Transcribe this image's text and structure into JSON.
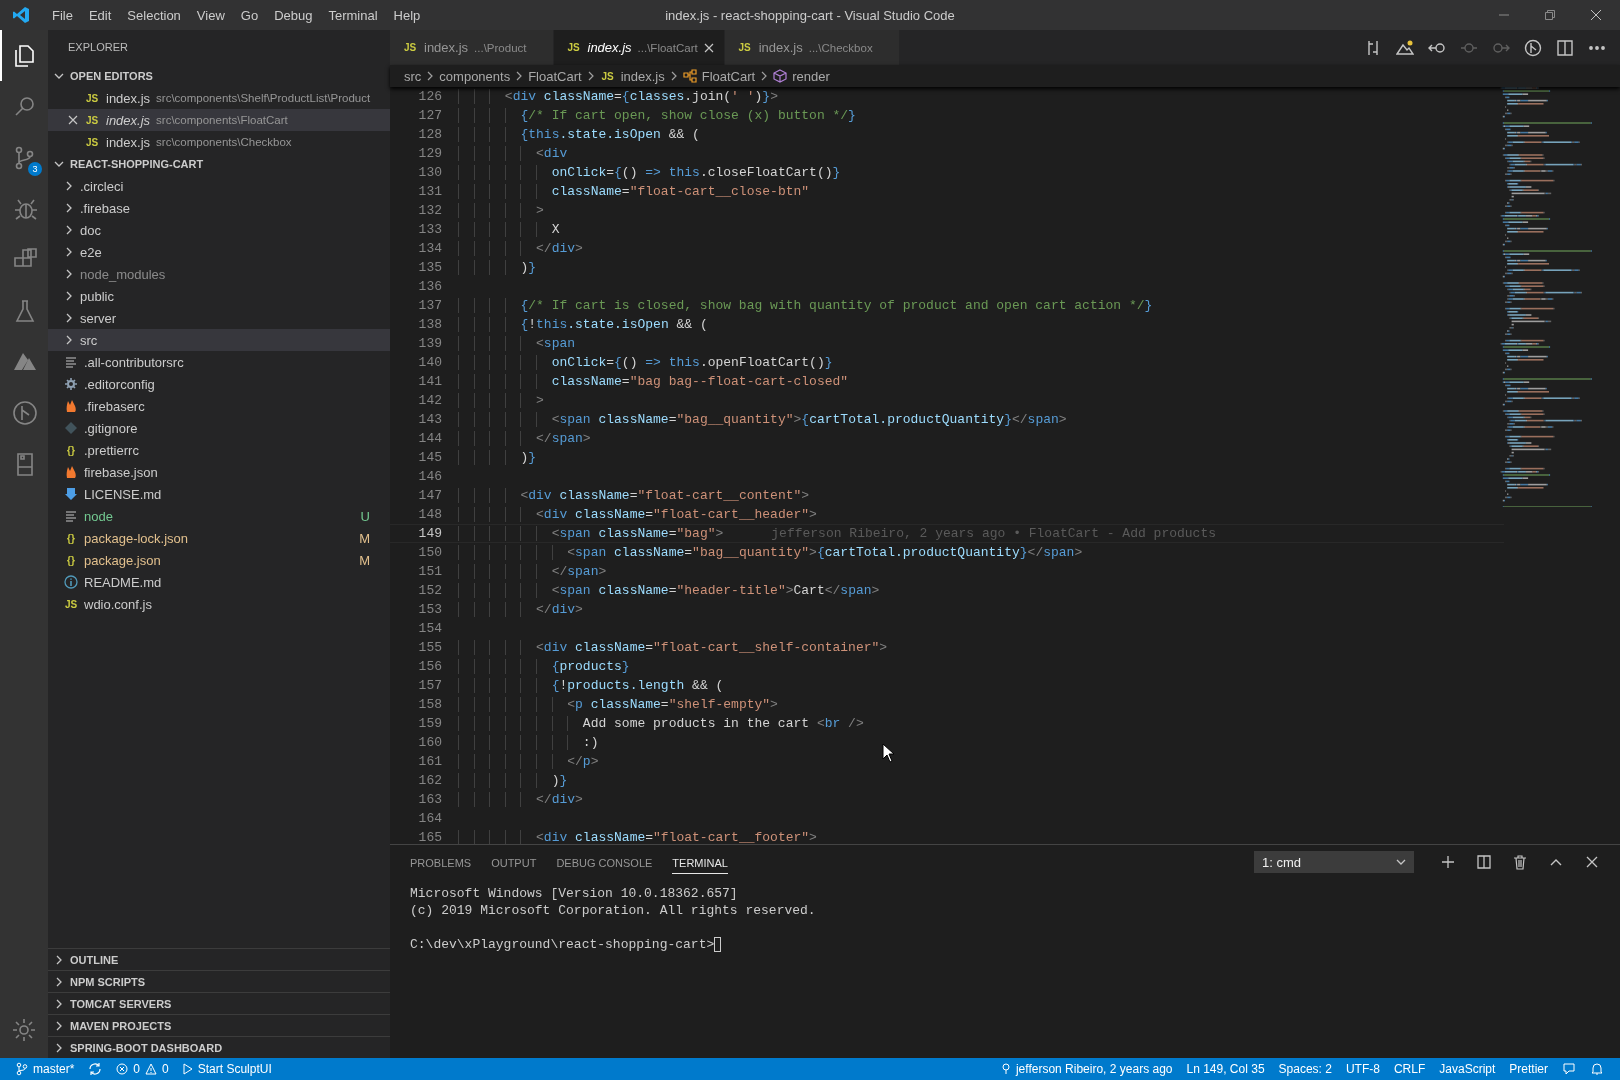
{
  "window": {
    "title": "index.js - react-shopping-cart - Visual Studio Code",
    "menu": [
      "File",
      "Edit",
      "Selection",
      "View",
      "Go",
      "Debug",
      "Terminal",
      "Help"
    ]
  },
  "activity_bar": {
    "items": [
      {
        "selected": true
      },
      {
        "selected": false
      },
      {
        "selected": false,
        "badge": "3"
      },
      {
        "selected": false
      },
      {
        "selected": false
      },
      {
        "selected": false
      },
      {
        "selected": false
      },
      {
        "selected": false
      },
      {
        "selected": false
      }
    ]
  },
  "sidebar": {
    "title": "EXPLORER",
    "open_editors": {
      "label": "OPEN EDITORS",
      "expanded": true,
      "items": [
        {
          "icon_label": "JS",
          "name": "index.js",
          "path": "src\\components\\Shelf\\ProductList\\Product",
          "selected": false,
          "preview": false
        },
        {
          "icon_label": "JS",
          "name": "index.js",
          "path": "src\\components\\FloatCart",
          "selected": true,
          "preview": true
        },
        {
          "icon_label": "JS",
          "name": "index.js",
          "path": "src\\components\\Checkbox",
          "selected": false,
          "preview": false
        }
      ]
    },
    "project": {
      "label": "REACT-SHOPPING-CART",
      "expanded": true,
      "items": [
        {
          "kind": "folder",
          "name": ".circleci",
          "expanded": false,
          "selected": false,
          "dimmed": false
        },
        {
          "kind": "folder",
          "name": ".firebase",
          "expanded": false,
          "selected": false,
          "dimmed": false
        },
        {
          "kind": "folder",
          "name": "doc",
          "expanded": false,
          "selected": false,
          "dimmed": false
        },
        {
          "kind": "folder",
          "name": "e2e",
          "expanded": false,
          "selected": false,
          "dimmed": false
        },
        {
          "kind": "folder",
          "name": "node_modules",
          "expanded": false,
          "selected": false,
          "dimmed": true
        },
        {
          "kind": "folder",
          "name": "public",
          "expanded": false,
          "selected": false,
          "dimmed": false
        },
        {
          "kind": "folder",
          "name": "server",
          "expanded": false,
          "selected": false,
          "dimmed": false
        },
        {
          "kind": "folder",
          "name": "src",
          "expanded": false,
          "selected": true,
          "dimmed": false
        },
        {
          "kind": "lines",
          "name": ".all-contributorsrc",
          "selected": false,
          "dimmed": false
        },
        {
          "kind": "gear",
          "name": ".editorconfig",
          "selected": false,
          "dimmed": false
        },
        {
          "kind": "fire",
          "name": ".firebaserc",
          "selected": false,
          "dimmed": false
        },
        {
          "kind": "git",
          "name": ".gitignore",
          "selected": false,
          "dimmed": false
        },
        {
          "kind": "label",
          "icon_label": "{}",
          "name": ".prettierrc",
          "selected": false,
          "dimmed": false
        },
        {
          "kind": "fire",
          "name": "firebase.json",
          "selected": false,
          "dimmed": false
        },
        {
          "kind": "download",
          "name": "LICENSE.md",
          "selected": false,
          "dimmed": false
        },
        {
          "kind": "lines",
          "name": "node",
          "status": "U",
          "color": "#73c991",
          "selected": false,
          "dimmed": false
        },
        {
          "kind": "label",
          "icon_label": "{}",
          "name": "package-lock.json",
          "status": "M",
          "color": "#e2c08d",
          "selected": false,
          "dimmed": false
        },
        {
          "kind": "label",
          "icon_label": "{}",
          "name": "package.json",
          "status": "M",
          "color": "#e2c08d",
          "selected": false,
          "dimmed": false
        },
        {
          "kind": "info",
          "name": "README.md",
          "selected": false,
          "dimmed": false
        },
        {
          "kind": "label",
          "icon_label": "JS",
          "name": "wdio.conf.js",
          "selected": false,
          "dimmed": false
        }
      ]
    },
    "sections": [
      {
        "label": "OUTLINE",
        "expanded": false
      },
      {
        "label": "NPM SCRIPTS",
        "expanded": false
      },
      {
        "label": "TOMCAT SERVERS",
        "expanded": false
      },
      {
        "label": "MAVEN PROJECTS",
        "expanded": false
      },
      {
        "label": "SPRING-BOOT DASHBOARD",
        "expanded": false
      }
    ]
  },
  "tabs": [
    {
      "icon_label": "JS",
      "label": "index.js",
      "path": "...\\Product",
      "selected": false,
      "preview": false
    },
    {
      "icon_label": "JS",
      "label": "index.js",
      "path": "...\\FloatCart",
      "selected": true,
      "preview": true
    },
    {
      "icon_label": "JS",
      "label": "index.js",
      "path": "...\\Checkbox",
      "selected": false,
      "preview": false
    }
  ],
  "editor_actions": [
    {
      "disabled": false
    },
    {
      "disabled": false
    },
    {
      "disabled": false
    },
    {
      "disabled": true
    },
    {
      "disabled": true
    },
    {
      "disabled": false
    },
    {
      "disabled": false
    },
    {
      "disabled": false
    }
  ],
  "breadcrumb": [
    {
      "kind": "folder",
      "label": "src"
    },
    {
      "kind": "folder",
      "label": "components"
    },
    {
      "kind": "folder",
      "label": "FloatCart"
    },
    {
      "kind": "file",
      "icon_label": "JS",
      "label": "index.js"
    },
    {
      "kind": "class",
      "label": "FloatCart"
    },
    {
      "kind": "method",
      "label": "render"
    }
  ],
  "code": [
    {
      "no": "126",
      "current": false,
      "tokens": [
        {
          "kind": "b",
          "text": "      <"
        },
        {
          "kind": "tag",
          "text": "div"
        },
        {
          "kind": "attr",
          "text": " className"
        },
        {
          "kind": "tx",
          "text": "="
        },
        {
          "kind": "kw",
          "text": "{"
        },
        {
          "kind": "var",
          "text": "classes"
        },
        {
          "kind": "tx",
          "text": ".join("
        },
        {
          "kind": "str",
          "text": "' '"
        },
        {
          "kind": "tx",
          "text": ")"
        },
        {
          "kind": "kw",
          "text": "}"
        },
        {
          "kind": "b",
          "text": ">"
        }
      ]
    },
    {
      "no": "127",
      "current": false,
      "tokens": [
        {
          "kind": "kw",
          "text": "        {"
        },
        {
          "kind": "com",
          "text": "/* If cart open, show close (x) button */"
        },
        {
          "kind": "kw",
          "text": "}"
        }
      ]
    },
    {
      "no": "128",
      "current": false,
      "tokens": [
        {
          "kind": "kw",
          "text": "        {this"
        },
        {
          "kind": "var",
          "text": ".state.isOpen"
        },
        {
          "kind": "tx",
          "text": " && ("
        }
      ]
    },
    {
      "no": "129",
      "current": false,
      "tokens": [
        {
          "kind": "b",
          "text": "          <"
        },
        {
          "kind": "tag",
          "text": "div"
        }
      ]
    },
    {
      "no": "130",
      "current": false,
      "tokens": [
        {
          "kind": "attr",
          "text": "            onClick"
        },
        {
          "kind": "tx",
          "text": "="
        },
        {
          "kind": "kw",
          "text": "{"
        },
        {
          "kind": "tx",
          "text": "() "
        },
        {
          "kind": "kw",
          "text": "=> this"
        },
        {
          "kind": "tx",
          "text": ".closeFloatCart()"
        },
        {
          "kind": "kw",
          "text": "}"
        }
      ]
    },
    {
      "no": "131",
      "current": false,
      "tokens": [
        {
          "kind": "attr",
          "text": "            className"
        },
        {
          "kind": "tx",
          "text": "="
        },
        {
          "kind": "str",
          "text": "\"float-cart__close-btn\""
        }
      ]
    },
    {
      "no": "132",
      "current": false,
      "tokens": [
        {
          "kind": "b",
          "text": "          >"
        }
      ]
    },
    {
      "no": "133",
      "current": false,
      "tokens": [
        {
          "kind": "tx",
          "text": "            X"
        }
      ]
    },
    {
      "no": "134",
      "current": false,
      "tokens": [
        {
          "kind": "b",
          "text": "          </"
        },
        {
          "kind": "tag",
          "text": "div"
        },
        {
          "kind": "b",
          "text": ">"
        }
      ]
    },
    {
      "no": "135",
      "current": false,
      "tokens": [
        {
          "kind": "tx",
          "text": "        )"
        },
        {
          "kind": "kw",
          "text": "}"
        }
      ]
    },
    {
      "no": "136",
      "current": false
    },
    {
      "no": "137",
      "current": false,
      "tokens": [
        {
          "kind": "kw",
          "text": "        {"
        },
        {
          "kind": "com",
          "text": "/* If cart is closed, show bag with quantity of product and open cart action */"
        },
        {
          "kind": "kw",
          "text": "}"
        }
      ]
    },
    {
      "no": "138",
      "current": false,
      "tokens": [
        {
          "kind": "kw",
          "text": "        {"
        },
        {
          "kind": "tx",
          "text": "!"
        },
        {
          "kind": "kw",
          "text": "this"
        },
        {
          "kind": "var",
          "text": ".state.isOpen"
        },
        {
          "kind": "tx",
          "text": " && ("
        }
      ]
    },
    {
      "no": "139",
      "current": false,
      "tokens": [
        {
          "kind": "b",
          "text": "          <"
        },
        {
          "kind": "tag",
          "text": "span"
        }
      ]
    },
    {
      "no": "140",
      "current": false,
      "tokens": [
        {
          "kind": "attr",
          "text": "            onClick"
        },
        {
          "kind": "tx",
          "text": "="
        },
        {
          "kind": "kw",
          "text": "{"
        },
        {
          "kind": "tx",
          "text": "() "
        },
        {
          "kind": "kw",
          "text": "=> this"
        },
        {
          "kind": "tx",
          "text": ".openFloatCart()"
        },
        {
          "kind": "kw",
          "text": "}"
        }
      ]
    },
    {
      "no": "141",
      "current": false,
      "tokens": [
        {
          "kind": "attr",
          "text": "            className"
        },
        {
          "kind": "tx",
          "text": "="
        },
        {
          "kind": "str",
          "text": "\"bag bag--float-cart-closed\""
        }
      ]
    },
    {
      "no": "142",
      "current": false,
      "tokens": [
        {
          "kind": "b",
          "text": "          >"
        }
      ]
    },
    {
      "no": "143",
      "current": false,
      "tokens": [
        {
          "kind": "b",
          "text": "            <"
        },
        {
          "kind": "tag",
          "text": "span"
        },
        {
          "kind": "attr",
          "text": " className"
        },
        {
          "kind": "tx",
          "text": "="
        },
        {
          "kind": "str",
          "text": "\"bag__quantity\""
        },
        {
          "kind": "b",
          "text": ">"
        },
        {
          "kind": "kw",
          "text": "{"
        },
        {
          "kind": "var",
          "text": "cartTotal.productQuantity"
        },
        {
          "kind": "kw",
          "text": "}"
        },
        {
          "kind": "b",
          "text": "</"
        },
        {
          "kind": "tag",
          "text": "span"
        },
        {
          "kind": "b",
          "text": ">"
        }
      ]
    },
    {
      "no": "144",
      "current": false,
      "tokens": [
        {
          "kind": "b",
          "text": "          </"
        },
        {
          "kind": "tag",
          "text": "span"
        },
        {
          "kind": "b",
          "text": ">"
        }
      ]
    },
    {
      "no": "145",
      "current": false,
      "tokens": [
        {
          "kind": "tx",
          "text": "        )"
        },
        {
          "kind": "kw",
          "text": "}"
        }
      ]
    },
    {
      "no": "146",
      "current": false
    },
    {
      "no": "147",
      "current": false,
      "tokens": [
        {
          "kind": "b",
          "text": "        <"
        },
        {
          "kind": "tag",
          "text": "div"
        },
        {
          "kind": "attr",
          "text": " className"
        },
        {
          "kind": "tx",
          "text": "="
        },
        {
          "kind": "str",
          "text": "\"float-cart__content\""
        },
        {
          "kind": "b",
          "text": ">"
        }
      ]
    },
    {
      "no": "148",
      "current": false,
      "tokens": [
        {
          "kind": "b",
          "text": "          <"
        },
        {
          "kind": "tag",
          "text": "div"
        },
        {
          "kind": "attr",
          "text": " className"
        },
        {
          "kind": "tx",
          "text": "="
        },
        {
          "kind": "str",
          "text": "\"float-cart__header\""
        },
        {
          "kind": "b",
          "text": ">"
        }
      ]
    },
    {
      "no": "149",
      "current": true,
      "blame": "jefferson Ribeiro, 2 years ago • FloatCart - Add products",
      "tokens": [
        {
          "kind": "b",
          "text": "            <"
        },
        {
          "kind": "tag",
          "text": "span"
        },
        {
          "kind": "attr",
          "text": " className"
        },
        {
          "kind": "tx",
          "text": "="
        },
        {
          "kind": "str",
          "text": "\"bag\""
        },
        {
          "kind": "b",
          "text": ">"
        }
      ]
    },
    {
      "no": "150",
      "current": false,
      "tokens": [
        {
          "kind": "b",
          "text": "              <"
        },
        {
          "kind": "tag",
          "text": "span"
        },
        {
          "kind": "attr",
          "text": " className"
        },
        {
          "kind": "tx",
          "text": "="
        },
        {
          "kind": "str",
          "text": "\"bag__quantity\""
        },
        {
          "kind": "b",
          "text": ">"
        },
        {
          "kind": "kw",
          "text": "{"
        },
        {
          "kind": "var",
          "text": "cartTotal.productQuantity"
        },
        {
          "kind": "kw",
          "text": "}"
        },
        {
          "kind": "b",
          "text": "</"
        },
        {
          "kind": "tag",
          "text": "span"
        },
        {
          "kind": "b",
          "text": ">"
        }
      ]
    },
    {
      "no": "151",
      "current": false,
      "tokens": [
        {
          "kind": "b",
          "text": "            </"
        },
        {
          "kind": "tag",
          "text": "span"
        },
        {
          "kind": "b",
          "text": ">"
        }
      ]
    },
    {
      "no": "152",
      "current": false,
      "tokens": [
        {
          "kind": "b",
          "text": "            <"
        },
        {
          "kind": "tag",
          "text": "span"
        },
        {
          "kind": "attr",
          "text": " className"
        },
        {
          "kind": "tx",
          "text": "="
        },
        {
          "kind": "str",
          "text": "\"header-title\""
        },
        {
          "kind": "b",
          "text": ">"
        },
        {
          "kind": "tx",
          "text": "Cart"
        },
        {
          "kind": "b",
          "text": "</"
        },
        {
          "kind": "tag",
          "text": "span"
        },
        {
          "kind": "b",
          "text": ">"
        }
      ]
    },
    {
      "no": "153",
      "current": false,
      "tokens": [
        {
          "kind": "b",
          "text": "          </"
        },
        {
          "kind": "tag",
          "text": "div"
        },
        {
          "kind": "b",
          "text": ">"
        }
      ]
    },
    {
      "no": "154",
      "current": false
    },
    {
      "no": "155",
      "current": false,
      "tokens": [
        {
          "kind": "b",
          "text": "          <"
        },
        {
          "kind": "tag",
          "text": "div"
        },
        {
          "kind": "attr",
          "text": " className"
        },
        {
          "kind": "tx",
          "text": "="
        },
        {
          "kind": "str",
          "text": "\"float-cart__shelf-container\""
        },
        {
          "kind": "b",
          "text": ">"
        }
      ]
    },
    {
      "no": "156",
      "current": false,
      "tokens": [
        {
          "kind": "kw",
          "text": "            {"
        },
        {
          "kind": "var",
          "text": "products"
        },
        {
          "kind": "kw",
          "text": "}"
        }
      ]
    },
    {
      "no": "157",
      "current": false,
      "tokens": [
        {
          "kind": "kw",
          "text": "            {"
        },
        {
          "kind": "tx",
          "text": "!"
        },
        {
          "kind": "var",
          "text": "products.length"
        },
        {
          "kind": "tx",
          "text": " && ("
        }
      ]
    },
    {
      "no": "158",
      "current": false,
      "tokens": [
        {
          "kind": "b",
          "text": "              <"
        },
        {
          "kind": "tag",
          "text": "p"
        },
        {
          "kind": "attr",
          "text": " className"
        },
        {
          "kind": "tx",
          "text": "="
        },
        {
          "kind": "str",
          "text": "\"shelf-empty\""
        },
        {
          "kind": "b",
          "text": ">"
        }
      ]
    },
    {
      "no": "159",
      "current": false,
      "tokens": [
        {
          "kind": "tx",
          "text": "                Add some products in the cart "
        },
        {
          "kind": "b",
          "text": "<"
        },
        {
          "kind": "tag",
          "text": "br"
        },
        {
          "kind": "b",
          "text": " />"
        }
      ]
    },
    {
      "no": "160",
      "current": false,
      "tokens": [
        {
          "kind": "tx",
          "text": "                :)"
        }
      ]
    },
    {
      "no": "161",
      "current": false,
      "tokens": [
        {
          "kind": "b",
          "text": "              </"
        },
        {
          "kind": "tag",
          "text": "p"
        },
        {
          "kind": "b",
          "text": ">"
        }
      ]
    },
    {
      "no": "162",
      "current": false,
      "tokens": [
        {
          "kind": "tx",
          "text": "            )"
        },
        {
          "kind": "kw",
          "text": "}"
        }
      ]
    },
    {
      "no": "163",
      "current": false,
      "tokens": [
        {
          "kind": "b",
          "text": "          </"
        },
        {
          "kind": "tag",
          "text": "div"
        },
        {
          "kind": "b",
          "text": ">"
        }
      ]
    },
    {
      "no": "164",
      "current": false
    },
    {
      "no": "165",
      "current": false,
      "tokens": [
        {
          "kind": "b",
          "text": "          <"
        },
        {
          "kind": "tag",
          "text": "div"
        },
        {
          "kind": "attr",
          "text": " className"
        },
        {
          "kind": "tx",
          "text": "="
        },
        {
          "kind": "str",
          "text": "\"float-cart__footer\""
        },
        {
          "kind": "b",
          "text": ">"
        }
      ]
    }
  ],
  "panel": {
    "tabs": [
      {
        "label": "PROBLEMS",
        "selected": false
      },
      {
        "label": "OUTPUT",
        "selected": false
      },
      {
        "label": "DEBUG CONSOLE",
        "selected": false
      },
      {
        "label": "TERMINAL",
        "selected": true
      }
    ],
    "terminal_select": "1: cmd",
    "terminal_lines": [
      "Microsoft Windows [Version 10.0.18362.657]",
      "(c) 2019 Microsoft Corporation. All rights reserved."
    ],
    "prompt": "C:\\dev\\xPlayground\\react-shopping-cart>"
  },
  "status_bar": {
    "branch": "master*",
    "errors": "0",
    "warnings": "0",
    "task": "Start SculptUI",
    "blame": "jefferson Ribeiro, 2 years ago",
    "items": [
      "Ln 149, Col 35",
      "Spaces: 2",
      "UTF-8",
      "CRLF",
      "JavaScript",
      "Prettier"
    ]
  }
}
